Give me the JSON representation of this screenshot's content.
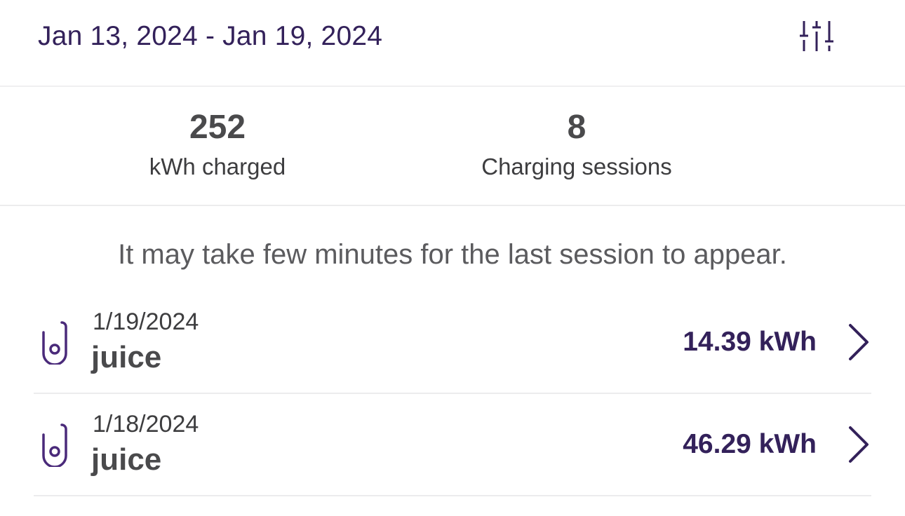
{
  "header": {
    "date_range": "Jan 13, 2024 - Jan 19, 2024",
    "filter_icon": "sliders-icon"
  },
  "stats": {
    "energy": {
      "value": "252",
      "label": "kWh charged"
    },
    "sessions": {
      "value": "8",
      "label": "Charging sessions"
    }
  },
  "notice": "It may take few minutes for the last session to appear.",
  "sessions": [
    {
      "date": "1/19/2024",
      "name": "juice",
      "energy": "14.39 kWh",
      "icon": "charger-icon"
    },
    {
      "date": "1/18/2024",
      "name": "juice",
      "energy": "46.29 kWh",
      "icon": "charger-icon"
    }
  ],
  "colors": {
    "accent": "#33215a",
    "icon": "#4a2a7a",
    "text_dark": "#4a4a4c",
    "divider": "#ececed"
  }
}
